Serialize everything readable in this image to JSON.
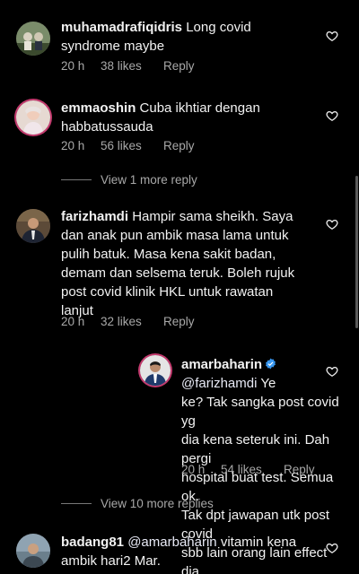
{
  "comments": [
    {
      "username": "muhamadrafiqidris",
      "text_line1": "Long covid",
      "text_line2": "syndrome maybe",
      "time": "20 h",
      "likes": "38 likes",
      "reply": "Reply"
    },
    {
      "username": "emmaoshin",
      "text_line1": "Cuba ikhtiar dengan",
      "text_line2": "habbatussauda",
      "time": "20 h",
      "likes": "56 likes",
      "reply": "Reply",
      "view_replies": "View 1 more reply"
    },
    {
      "username": "farizhamdi",
      "text_line1": "Hampir sama sheikh. Saya",
      "text_line2": "dan anak pun ambik masa lama untuk",
      "text_line3": "pulih batuk.  Masa kena sakit badan,",
      "text_line4": "demam dan selsema teruk. Boleh rujuk",
      "text_line5": "post covid klinik HKL untuk rawatan",
      "text_line6": "lanjut",
      "time": "20 h",
      "likes": "32 likes",
      "reply": "Reply"
    },
    {
      "username": "amarbaharin",
      "mention": "@farizhamdi",
      "text_line1": "Ye",
      "text_line2": "ke? Tak sangka post covid yg",
      "text_line3": "dia kena seteruk ini. Dah pergi",
      "text_line4": "hospital buat test. Semua ok.",
      "text_line5": "Tak dpt jawapan utk post covid",
      "text_line6": "sbb lain orang lain effect dia",
      "time": "20 h",
      "likes": "54 likes",
      "reply": "Reply",
      "view_replies": "View 10 more replies"
    },
    {
      "username": "badang81",
      "mention": "@amarbaharin",
      "text_line1": "vitamin kena",
      "text_line2": "ambik hari2 Mar."
    }
  ],
  "colors": {
    "background": "#000000",
    "text": "#f2f2f2",
    "secondary": "#a8a8a8",
    "verified": "#3897f0",
    "story_ring": "#c43a6e"
  }
}
